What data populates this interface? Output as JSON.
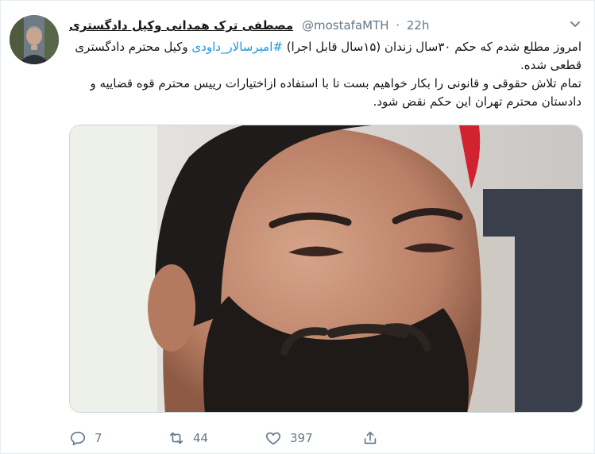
{
  "tweet": {
    "display_name": "مصطفی ترک همدانی وکیل دادگستری",
    "handle": "@mostafaMTH",
    "separator": "·",
    "time": "22h",
    "text_line1_pre": "امروز مطلع شدم که حکم ۳۰سال زندان (۱۵سال قابل اجرا) ",
    "hashtag": "#امیرسالار_داودی",
    "text_line1_post": " وکیل محترم دادگستری قطعی شده.",
    "text_para2": "تمام تلاش حقوقی و قانونی را بکار خواهیم بست تا با استفاده ازاختیارات رییس محترم قوه قضاییه و دادستان محترم تهران این حکم نقض شود."
  },
  "actions": {
    "reply_count": "7",
    "retweet_count": "44",
    "like_count": "397"
  },
  "icons": {
    "reply": "reply-icon",
    "retweet": "retweet-icon",
    "like": "heart-icon",
    "share": "share-icon",
    "menu": "chevron-down-icon"
  },
  "colors": {
    "link": "#1b95e0",
    "muted": "#657786",
    "text": "#14171a"
  }
}
